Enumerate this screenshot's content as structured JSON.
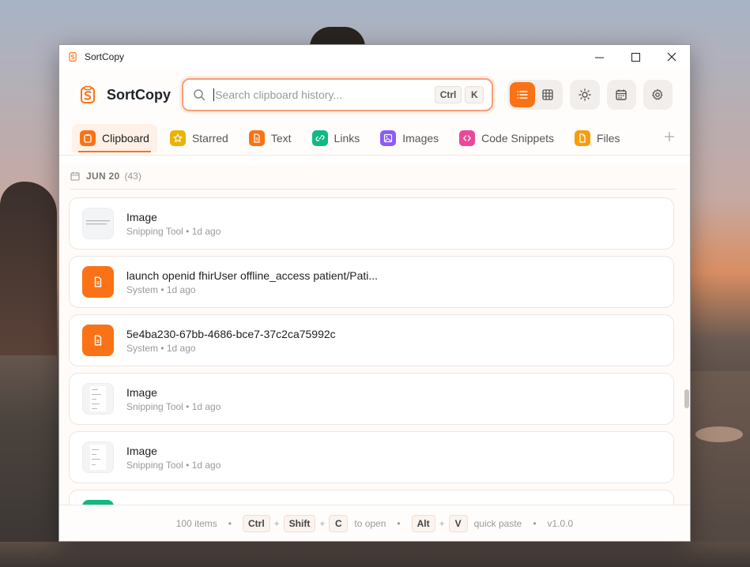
{
  "window": {
    "title": "SortCopy"
  },
  "header": {
    "brand": "SortCopy",
    "search": {
      "placeholder": "Search clipboard history...",
      "value": "",
      "shortcut": [
        "Ctrl",
        "K"
      ]
    }
  },
  "tabs": [
    {
      "label": "Clipboard",
      "icon": "clipboard-icon",
      "color": "#f97316",
      "active": true
    },
    {
      "label": "Starred",
      "icon": "star-icon",
      "color": "#eab308"
    },
    {
      "label": "Text",
      "icon": "document-icon",
      "color": "#f97316"
    },
    {
      "label": "Links",
      "icon": "link-icon",
      "color": "#10b981"
    },
    {
      "label": "Images",
      "icon": "image-icon",
      "color": "#8b5cf6"
    },
    {
      "label": "Code Snippets",
      "icon": "code-icon",
      "color": "#ec4899"
    },
    {
      "label": "Files",
      "icon": "file-icon",
      "color": "#f59e0b"
    }
  ],
  "date_group": {
    "label": "JUN 20",
    "count": "(43)"
  },
  "items": [
    {
      "type": "image",
      "title": "Image",
      "meta": "Snipping Tool • 1d ago"
    },
    {
      "type": "text",
      "title": "launch openid fhirUser offline_access patient/Pati...",
      "meta": "System • 1d ago"
    },
    {
      "type": "text",
      "title": "5e4ba230-67bb-4686-bce7-37c2ca75992c",
      "meta": "System • 1d ago"
    },
    {
      "type": "image",
      "title": "Image",
      "meta": "Snipping Tool • 1d ago"
    },
    {
      "type": "image",
      "title": "Image",
      "meta": "Snipping Tool • 1d ago"
    }
  ],
  "footer": {
    "count": "100 items",
    "open_keys": [
      "Ctrl",
      "Shift",
      "C"
    ],
    "open_label": "to open",
    "paste_keys": [
      "Alt",
      "V"
    ],
    "paste_label": "quick paste",
    "version": "v1.0.0"
  },
  "colors": {
    "accent": "#f97316",
    "accent_light": "#fff1e7"
  }
}
